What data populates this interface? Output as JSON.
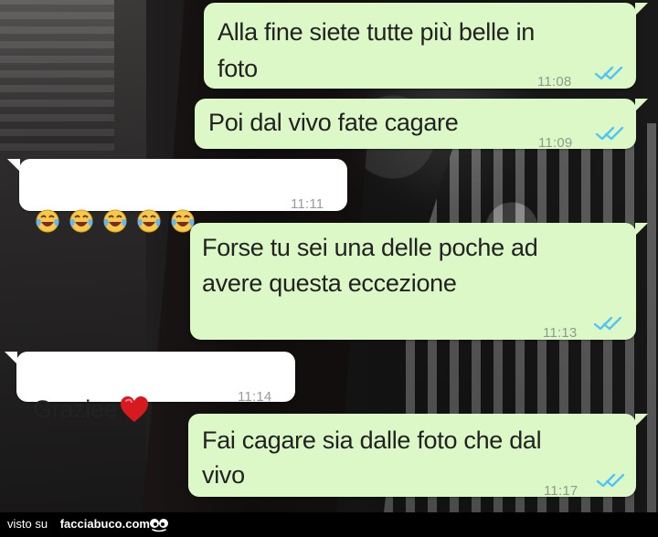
{
  "chat": {
    "messages": [
      {
        "text": "Alla fine siete tutte più belle in\nfoto",
        "time": "11:08",
        "direction": "sent",
        "status": "read-double-check"
      },
      {
        "text": "Poi dal vivo fate cagare",
        "time": "11:09",
        "direction": "sent",
        "status": "read-double-check"
      },
      {
        "emoji": [
          "face-with-tears-of-joy",
          "face-with-tears-of-joy",
          "face-with-tears-of-joy",
          "face-with-tears-of-joy",
          "face-with-tears-of-joy"
        ],
        "time": "11:11",
        "direction": "received"
      },
      {
        "text": "Forse tu sei una delle poche ad\navere questa eccezione",
        "time": "11:13",
        "direction": "sent",
        "status": "read-double-check"
      },
      {
        "text": "Graziee",
        "emoji_suffix": "red-heart",
        "time": "11:14",
        "direction": "received"
      },
      {
        "text": "Fai cagare sia dalle foto che dal\nvivo",
        "time": "11:17",
        "direction": "sent",
        "status": "read-double-check"
      }
    ]
  },
  "footer": {
    "visto_label": "visto su",
    "site_label": "facciabuco.com",
    "logo_icon": "eyes-icon"
  },
  "colors": {
    "sent_bubble": "#dcf8c6",
    "received_bubble": "#ffffff",
    "read_check": "#4fc3f7",
    "footer_background": "#000000"
  }
}
